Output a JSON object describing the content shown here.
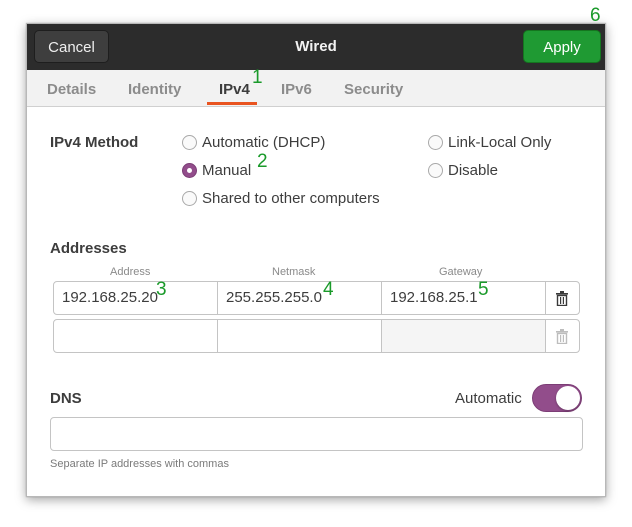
{
  "window": {
    "title": "Wired",
    "cancel_label": "Cancel",
    "apply_label": "Apply"
  },
  "tabs": [
    {
      "label": "Details",
      "active": false
    },
    {
      "label": "Identity",
      "active": false
    },
    {
      "label": "IPv4",
      "active": true
    },
    {
      "label": "IPv6",
      "active": false
    },
    {
      "label": "Security",
      "active": false
    }
  ],
  "ipv4_method": {
    "label": "IPv4 Method",
    "options": [
      {
        "label": "Automatic (DHCP)",
        "checked": false
      },
      {
        "label": "Manual",
        "checked": true
      },
      {
        "label": "Shared to other computers",
        "checked": false
      },
      {
        "label": "Link-Local Only",
        "checked": false
      },
      {
        "label": "Disable",
        "checked": false
      }
    ]
  },
  "addresses": {
    "label": "Addresses",
    "columns": [
      "Address",
      "Netmask",
      "Gateway"
    ],
    "rows": [
      {
        "address": "192.168.25.20",
        "netmask": "255.255.255.0",
        "gateway": "192.168.25.1",
        "delete_enabled": true
      },
      {
        "address": "",
        "netmask": "",
        "gateway": "",
        "delete_enabled": false
      }
    ]
  },
  "dns": {
    "label": "DNS",
    "automatic_label": "Automatic",
    "automatic_on": true,
    "value": "",
    "hint": "Separate IP addresses with commas"
  },
  "callouts": [
    "1",
    "2",
    "3",
    "4",
    "5",
    "6"
  ],
  "colors": {
    "apply_green": "#1f9a33",
    "accent_purple": "#924d8b",
    "tab_underline": "#e95420",
    "callout_green": "#1a9a2a"
  },
  "icons": {
    "delete": "trash-icon"
  }
}
